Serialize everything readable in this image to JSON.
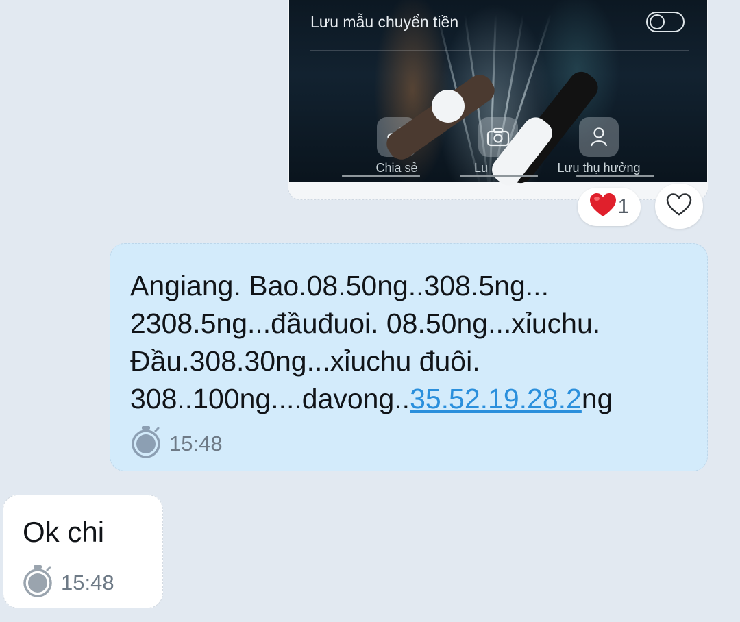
{
  "transfer_image": {
    "save_template_label": "Lưu mẫu chuyển tiền",
    "toggle_state": "off",
    "actions": [
      {
        "label": "Chia sẻ",
        "icon": "share-icon"
      },
      {
        "label": "Lu",
        "icon": "camera-icon"
      },
      {
        "label": "Lưu thụ hưởng",
        "icon": "person-icon"
      }
    ]
  },
  "reaction": {
    "emoji": "heart",
    "count": "1",
    "like_icon": "heart-outline-icon"
  },
  "outgoing_message": {
    "line1": "Angiang. Bao.08.50ng..308.5ng...",
    "line2": "2308.5ng...đầuđuoi. 08.50ng...xỉuchu.",
    "line3": "Đầu.308.30ng...xỉuchu đuôi.",
    "line4_prefix": "308..100ng....davong..",
    "line4_link": "35.52.19.28.2",
    "line4_suffix": "ng",
    "time": "15:48",
    "status_icon": "timer-icon"
  },
  "incoming_message": {
    "text": "Ok chi",
    "time": "15:48",
    "status_icon": "timer-icon"
  },
  "colors": {
    "background": "#e2e9f1",
    "outgoing_bubble": "#d3ebfb",
    "incoming_bubble": "#ffffff",
    "link": "#2a8fdc",
    "reaction_heart": "#e0202c"
  }
}
